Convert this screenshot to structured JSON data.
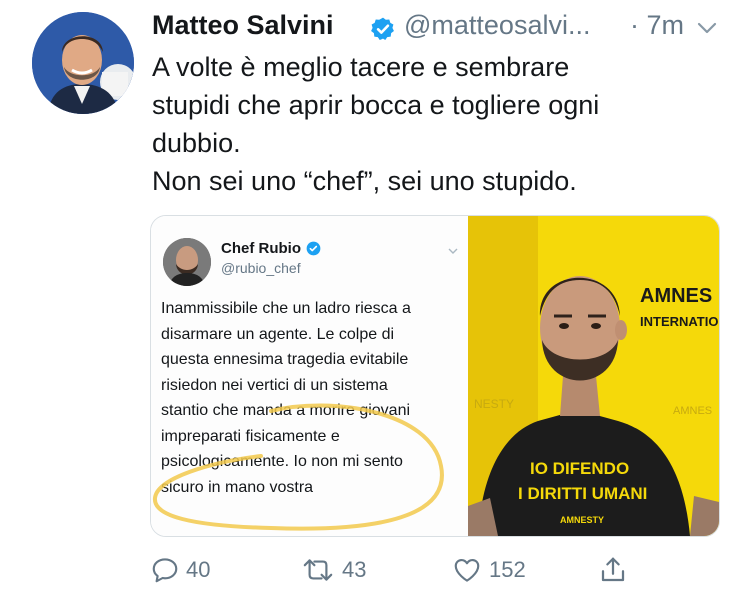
{
  "tweet": {
    "author_name": "Matteo Salvini",
    "author_handle": "@matteosalvi...",
    "time": "· 7m",
    "verified_color": "#1da1f2",
    "text_lines": [
      "A volte è meglio tacere e sembrare",
      "stupidi che aprir bocca e togliere ogni",
      "dubbio.",
      "Non sei uno “chef”, sei uno stupido."
    ]
  },
  "embedded": {
    "author_name": "Chef Rubio",
    "author_handle": "@rubio_chef",
    "text_lines": [
      "Inammissibile che un ladro riesca a",
      "disarmare un agente. Le colpe di",
      "questa ennesima tragedia evitabile",
      "risiedon nei vertici di un sistema",
      "stantio che manda a morire giovani",
      "impreparati fisicamente e",
      "psicologicamente. Io non mi sento",
      "sicuro in mano vostra"
    ],
    "highlight_color": "#f2c94c"
  },
  "photo": {
    "banner_line1": "AMNES",
    "banner_line2": "INTERNATIO",
    "banner_faint": "NESTY",
    "banner_faint2": "AMNES",
    "shirt_line1": "IO DIFENDO",
    "shirt_line2": "I DIRITTI UMANI",
    "shirt_small": "AMNESTY",
    "bg_color": "#f5d90a",
    "shirt_color": "#1c1c1c"
  },
  "actions": {
    "reply_count": "40",
    "retweet_count": "43",
    "like_count": "152",
    "icon_color": "#657786"
  }
}
